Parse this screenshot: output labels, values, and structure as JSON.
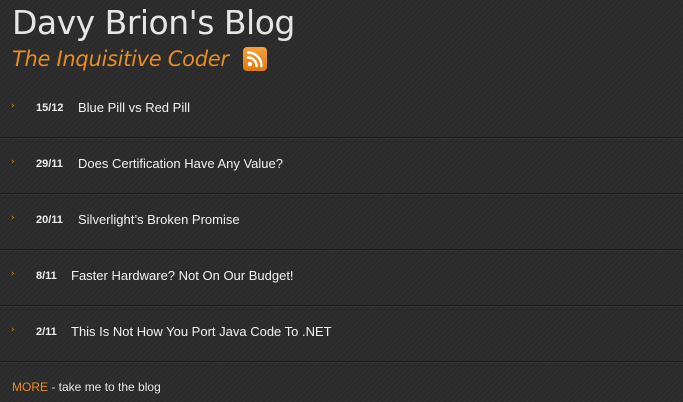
{
  "blog": {
    "title": "Davy Brion's Blog",
    "tagline": "The Inquisitive Coder"
  },
  "icons": {
    "feed": "rss-feed-icon",
    "bullet": "chevron-right-icon"
  },
  "colors": {
    "accent": "#e88d1f",
    "background": "#2b2b2b"
  },
  "posts": [
    {
      "date": "15/12",
      "title": "Blue Pill vs Red Pill"
    },
    {
      "date": "29/11",
      "title": "Does Certification Have Any Value?"
    },
    {
      "date": "20/11",
      "title": "Silverlight’s Broken Promise"
    },
    {
      "date": "8/11",
      "title": "Faster Hardware? Not On Our Budget!"
    },
    {
      "date": "2/11",
      "title": "This Is Not How You Port Java Code To .NET"
    }
  ],
  "more": {
    "link": "MORE",
    "text": "- take me to the blog"
  }
}
